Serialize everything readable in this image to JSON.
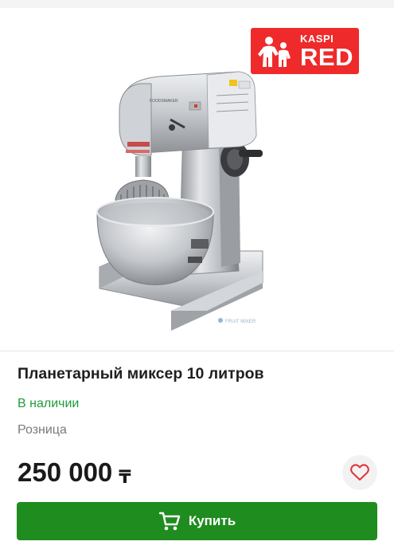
{
  "badge": {
    "brand": "KASPI",
    "label": "RED",
    "color": "#ef2a2a",
    "icon": "kaspi-red-figure-icon"
  },
  "product": {
    "title": "Планетарный миксер 10 литров",
    "availability": "В наличии",
    "sale_type": "Розница",
    "price": "250 000",
    "currency": "₸",
    "image_label": "FOODSMAKER",
    "image_icon": "planetary-mixer-image"
  },
  "actions": {
    "favorite_icon": "heart-icon",
    "buy_label": "Купить",
    "buy_icon": "cart-icon",
    "buy_color": "#1f8c1f"
  },
  "colors": {
    "availability": "#1e9c3a",
    "favorite_heart": "#e0343a"
  }
}
